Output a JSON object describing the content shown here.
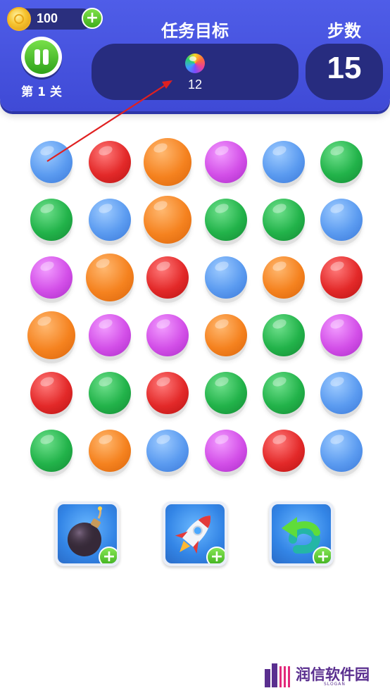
{
  "hud": {
    "coins": "100",
    "coin_icon": "coin-icon",
    "add_coins_symbol": "+",
    "pause_icon": "pause-icon",
    "level_label": "第 1 关",
    "task_title": "任务目标",
    "target_icon": "rainbow-ball-icon",
    "target_count": "12",
    "steps_title": "步数",
    "steps_value": "15"
  },
  "board": {
    "rows": 6,
    "cols": 6,
    "cells": [
      [
        "blue",
        "red",
        "orange",
        "purple",
        "blue",
        "green"
      ],
      [
        "green",
        "blue",
        "orange",
        "green",
        "green",
        "blue"
      ],
      [
        "purple",
        "orange",
        "red",
        "blue",
        "orange",
        "red"
      ],
      [
        "orange",
        "purple",
        "purple",
        "orange",
        "green",
        "purple"
      ],
      [
        "red",
        "green",
        "red",
        "green",
        "green",
        "blue"
      ],
      [
        "green",
        "orange",
        "blue",
        "purple",
        "red",
        "blue"
      ]
    ],
    "large_balls": [
      [
        0,
        2
      ],
      [
        1,
        2
      ],
      [
        2,
        1
      ],
      [
        3,
        0
      ]
    ],
    "colors": {
      "blue": "#5b9bf0",
      "red": "#e32929",
      "orange": "#f5821f",
      "purple": "#d34fe8",
      "green": "#22b34a"
    }
  },
  "powerups": [
    {
      "name": "bomb",
      "icon": "bomb-icon",
      "add_symbol": "+"
    },
    {
      "name": "rocket",
      "icon": "rocket-icon",
      "add_symbol": "+"
    },
    {
      "name": "undo",
      "icon": "undo-arrow-icon",
      "add_symbol": "+"
    }
  ],
  "annotation": {
    "type": "arrow",
    "color": "#e02020"
  },
  "watermark": {
    "text": "润信软件园",
    "slogan": "SLOGAN",
    "color": "#5a2f8f"
  },
  "theme": {
    "header_bg": "#4a56e2",
    "panel_bg": "#272c7f",
    "accent_green": "#3fae1c"
  }
}
